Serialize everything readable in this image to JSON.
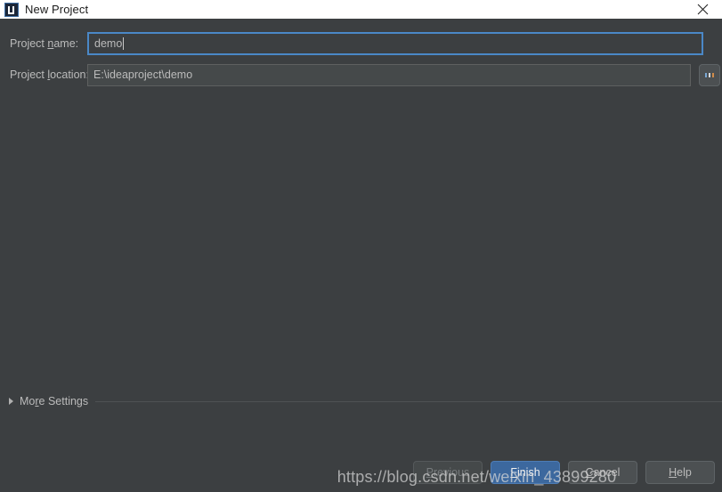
{
  "window": {
    "title": "New Project",
    "app_icon": "intellij-idea-icon",
    "close_icon": "close-icon",
    "title_bar_bg": "#ffffff",
    "body_bg": "#3c3f41"
  },
  "form": {
    "name_field": {
      "label_prefix": "Project ",
      "label_mnemonic": "n",
      "label_suffix": "ame:",
      "value": "demo",
      "placeholder": "",
      "focused": true
    },
    "location_field": {
      "label_prefix": "Project ",
      "label_mnemonic": "l",
      "label_suffix": "ocation:",
      "value": "E:\\ideaproject\\demo",
      "placeholder": "",
      "focused": false
    },
    "browse_button": {
      "label": "...",
      "icon": "ellipsis-browse-icon"
    }
  },
  "more_settings": {
    "label_prefix": "Mo",
    "label_mnemonic": "r",
    "label_suffix": "e Settings",
    "expanded": false,
    "disclosure_icon": "chevron-right-icon"
  },
  "buttons": {
    "previous": {
      "mnemonic": "P",
      "rest": "revious",
      "enabled": false,
      "default": false
    },
    "finish": {
      "mnemonic": "F",
      "rest": "inish",
      "enabled": true,
      "default": true,
      "accent": "#3c689e"
    },
    "cancel": {
      "mnemonic": "C",
      "rest": "ancel",
      "enabled": true,
      "default": false
    },
    "help": {
      "mnemonic": "H",
      "rest": "elp",
      "enabled": true,
      "default": false
    }
  },
  "watermark": {
    "text": "https://blog.csdn.net/weixin_43899280"
  }
}
